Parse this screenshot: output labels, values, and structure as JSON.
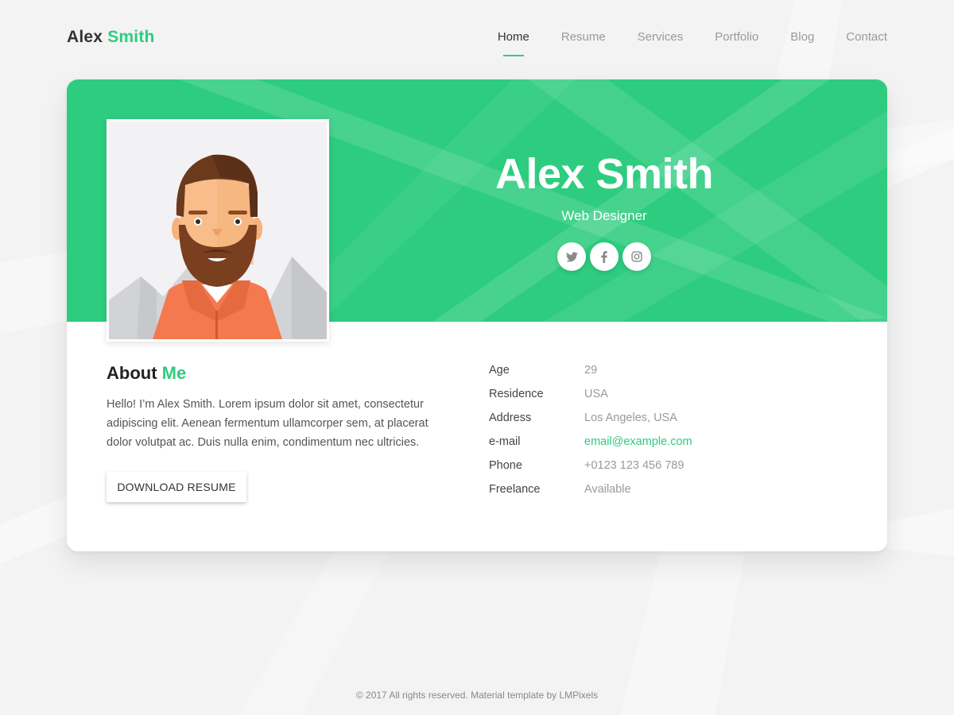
{
  "header": {
    "logo_first": "Alex",
    "logo_second": "Smith",
    "nav": [
      {
        "label": "Home",
        "active": true
      },
      {
        "label": "Resume"
      },
      {
        "label": "Services"
      },
      {
        "label": "Portfolio"
      },
      {
        "label": "Blog"
      },
      {
        "label": "Contact"
      }
    ]
  },
  "hero": {
    "name": "Alex Smith",
    "title": "Web Designer",
    "socials": [
      {
        "icon": "twitter-icon"
      },
      {
        "icon": "facebook-icon"
      },
      {
        "icon": "instagram-icon"
      }
    ]
  },
  "about": {
    "title_first": "About",
    "title_second": "Me",
    "text": "Hello! I’m Alex Smith. Lorem ipsum dolor sit amet, consectetur adipiscing elit. Aenean fermentum ullamcorper sem, at placerat dolor volutpat ac. Duis nulla enim, condimentum nec ultricies.",
    "button_label": "DOWNLOAD RESUME"
  },
  "info": [
    {
      "label": "Age",
      "value": "29"
    },
    {
      "label": "Residence",
      "value": "USA"
    },
    {
      "label": "Address",
      "value": "Los Angeles, USA"
    },
    {
      "label": "e-mail",
      "value": "email@example.com"
    },
    {
      "label": "Phone",
      "value": "+0123 123 456 789"
    },
    {
      "label": "Freelance",
      "value": "Available"
    }
  ],
  "footer": {
    "text": "© 2017 All rights reserved. Material template by LMPixels"
  },
  "colors": {
    "accent": "#2ecc7f",
    "background": "#f3f3f3",
    "card": "#ffffff",
    "text_dark": "#333333",
    "text_muted": "#9a9a9a"
  }
}
